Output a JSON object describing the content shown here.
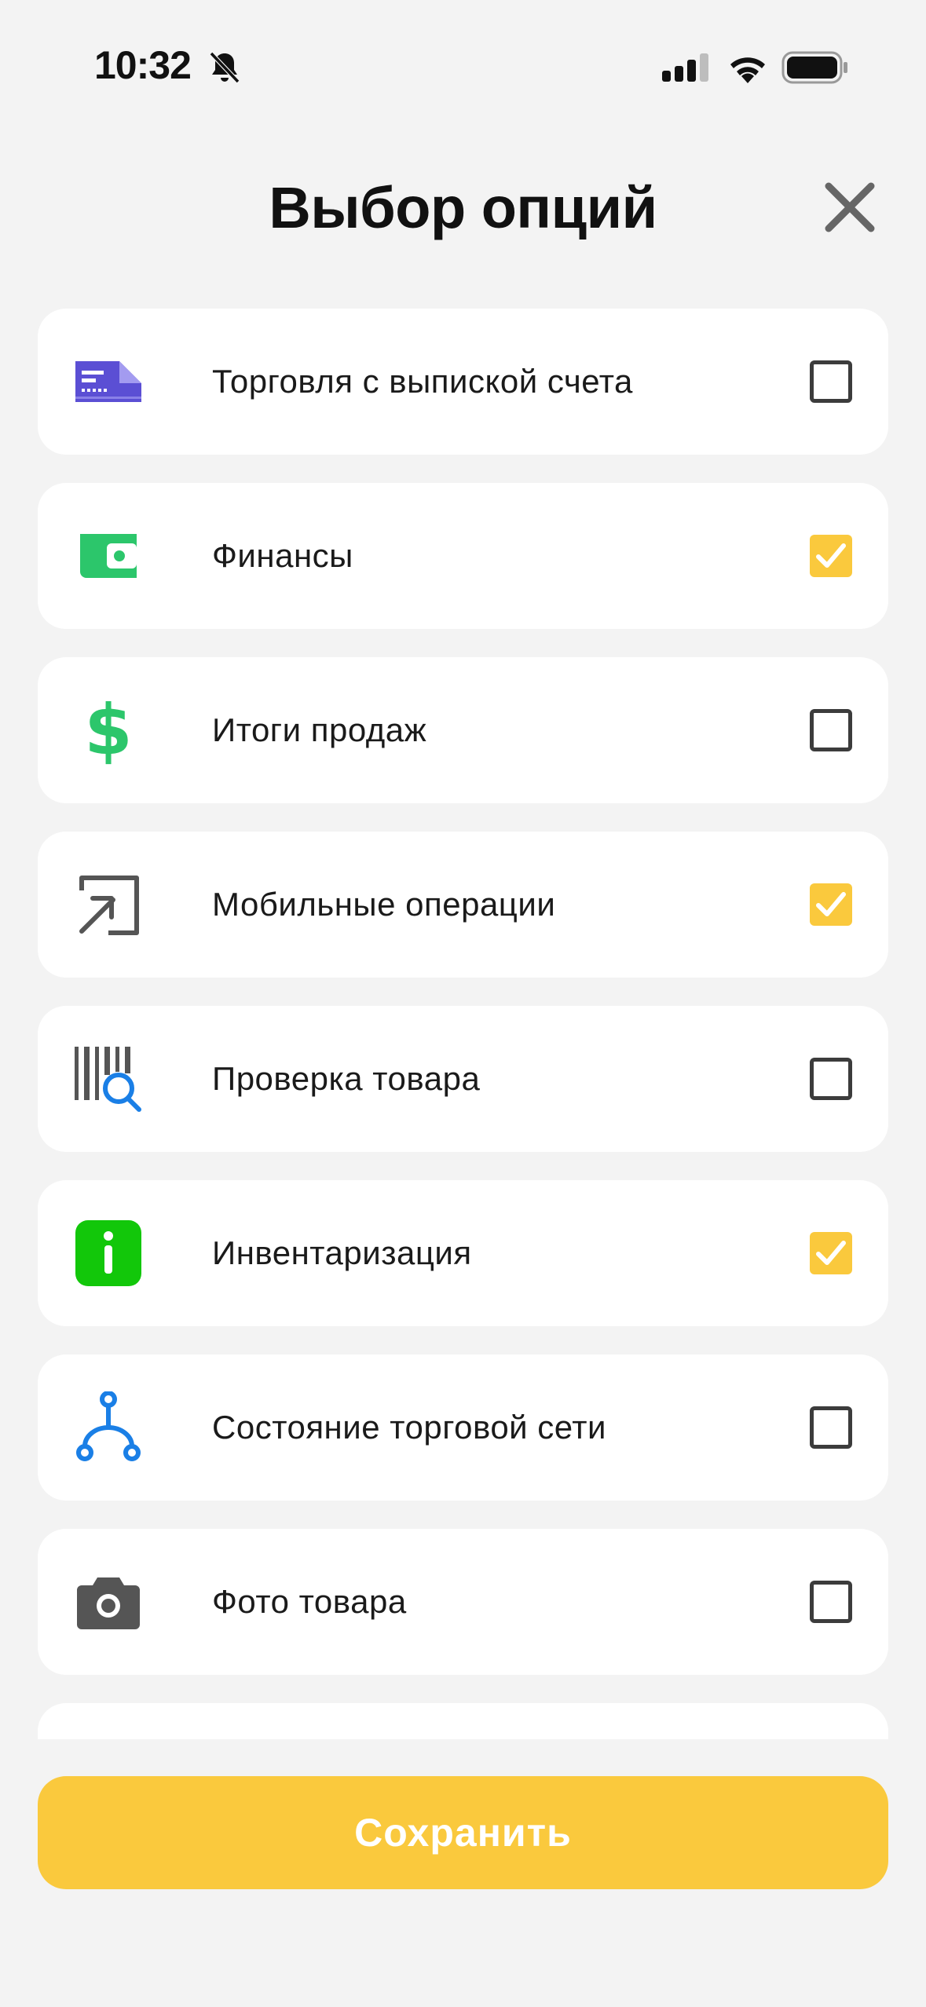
{
  "status_bar": {
    "time": "10:32"
  },
  "header": {
    "title": "Выбор опций"
  },
  "options": [
    {
      "label": "Торговля с выпиской счета",
      "icon": "invoice-card-icon",
      "checked": false
    },
    {
      "label": "Финансы",
      "icon": "wallet-icon",
      "checked": true
    },
    {
      "label": "Итоги продаж",
      "icon": "dollar-icon",
      "checked": false
    },
    {
      "label": "Мобильные операции",
      "icon": "arrow-in-box-icon",
      "checked": true
    },
    {
      "label": "Проверка товара",
      "icon": "barcode-search-icon",
      "checked": false
    },
    {
      "label": "Инвентаризация",
      "icon": "info-icon",
      "checked": true
    },
    {
      "label": "Состояние торговой сети",
      "icon": "network-icon",
      "checked": false
    },
    {
      "label": "Фото товара",
      "icon": "camera-icon",
      "checked": false
    }
  ],
  "footer": {
    "save_label": "Сохранить"
  },
  "colors": {
    "accent": "#fac93d",
    "background": "#f3f3f3",
    "card": "#ffffff"
  }
}
